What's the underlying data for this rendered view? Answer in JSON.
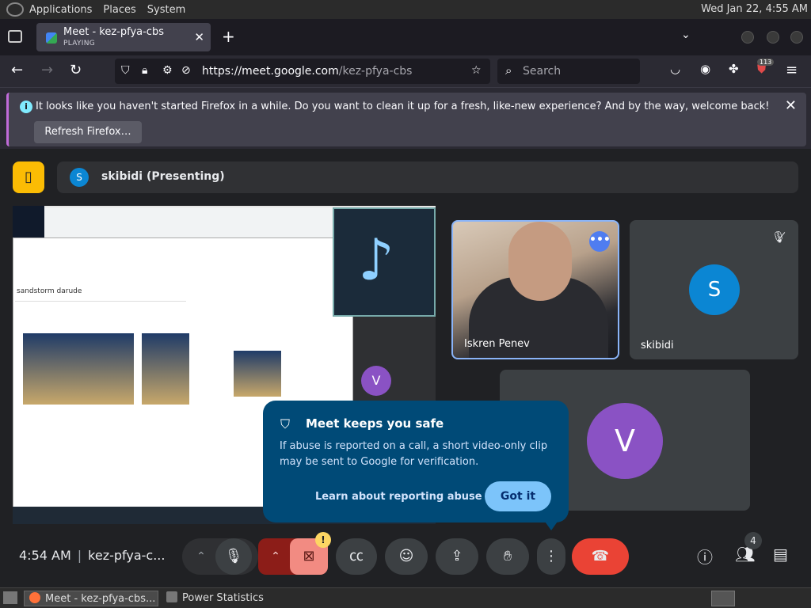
{
  "panel": {
    "menus": [
      "Applications",
      "Places",
      "System"
    ],
    "clock": "Wed Jan 22,  4:55 AM"
  },
  "browser": {
    "tab": {
      "title": "Meet - kez-pfya-cbs",
      "status": "PLAYING"
    },
    "url_host": "https://meet.google.com",
    "url_path": "/kez-pfya-cbs",
    "search_placeholder": "Search",
    "extension_badge": "113"
  },
  "notification": {
    "message": "It looks like you haven't started Firefox in a while. Do you want to clean it up for a fresh, like-new experience? And by the way, welcome back!",
    "button": "Refresh Firefox…"
  },
  "meet": {
    "presenting": {
      "avatar": "S",
      "label": "skibidi (Presenting)"
    },
    "tiles": [
      {
        "name": "Iskren Penev"
      },
      {
        "name": "skibidi",
        "avatar": "S"
      },
      {
        "avatar": "V"
      }
    ],
    "shared_screen": {
      "search_text": "sandstorm darude",
      "avatar": "V"
    },
    "safety_popup": {
      "title": "Meet keeps you safe",
      "body": "If abuse is reported on a call, a short video-only clip may be sent to Google for verification.",
      "link": "Learn about reporting abuse",
      "button": "Got it"
    },
    "controls": {
      "time": "4:54 AM",
      "meeting_code": "kez-pfya-c...",
      "participants_count": "4"
    }
  },
  "taskbar": {
    "items": [
      "Meet - kez-pfya-cbs...",
      "Power Statistics"
    ]
  },
  "colors": {
    "meet_bg": "#202124",
    "popup_bg": "#004a77",
    "end_call": "#ea4335",
    "accent": "#8ab4f8"
  }
}
